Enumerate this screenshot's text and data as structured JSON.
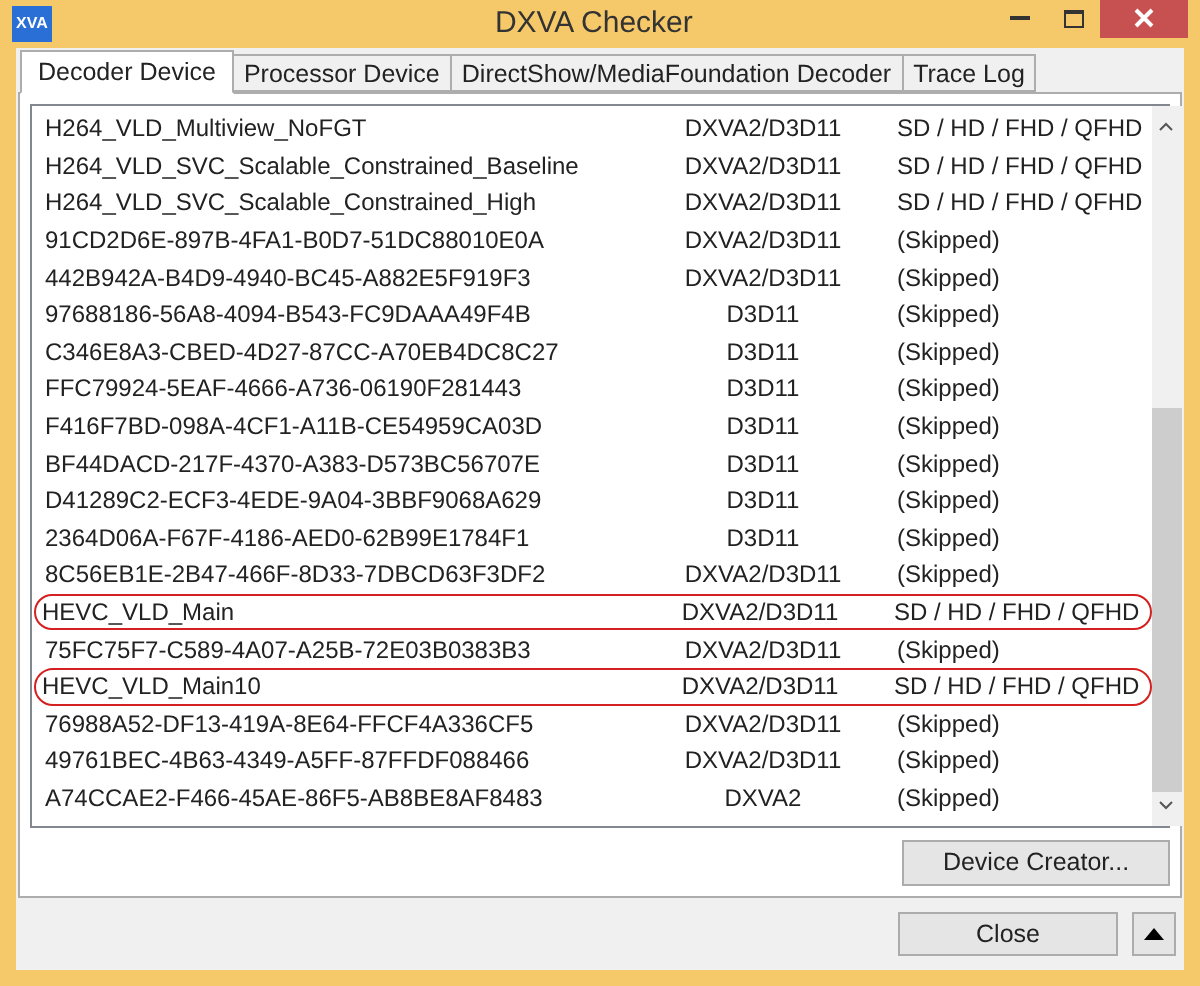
{
  "window": {
    "title": "DXVA Checker",
    "icon_text": "XVA"
  },
  "tabs": [
    {
      "label": "Decoder Device",
      "selected": true
    },
    {
      "label": "Processor Device",
      "selected": false
    },
    {
      "label": "DirectShow/MediaFoundation Decoder",
      "selected": false
    },
    {
      "label": "Trace Log",
      "selected": false
    }
  ],
  "rows": [
    {
      "name": "H264_VLD_Multiview_NoFGT",
      "api": "DXVA2/D3D11",
      "support": "SD / HD / FHD / QFHD",
      "highlighted": false
    },
    {
      "name": "H264_VLD_SVC_Scalable_Constrained_Baseline",
      "api": "DXVA2/D3D11",
      "support": "SD / HD / FHD / QFHD",
      "highlighted": false
    },
    {
      "name": "H264_VLD_SVC_Scalable_Constrained_High",
      "api": "DXVA2/D3D11",
      "support": "SD / HD / FHD / QFHD",
      "highlighted": false
    },
    {
      "name": "91CD2D6E-897B-4FA1-B0D7-51DC88010E0A",
      "api": "DXVA2/D3D11",
      "support": "(Skipped)",
      "highlighted": false
    },
    {
      "name": "442B942A-B4D9-4940-BC45-A882E5F919F3",
      "api": "DXVA2/D3D11",
      "support": "(Skipped)",
      "highlighted": false
    },
    {
      "name": "97688186-56A8-4094-B543-FC9DAAA49F4B",
      "api": "D3D11",
      "support": "(Skipped)",
      "highlighted": false
    },
    {
      "name": "C346E8A3-CBED-4D27-87CC-A70EB4DC8C27",
      "api": "D3D11",
      "support": "(Skipped)",
      "highlighted": false
    },
    {
      "name": "FFC79924-5EAF-4666-A736-06190F281443",
      "api": "D3D11",
      "support": "(Skipped)",
      "highlighted": false
    },
    {
      "name": "F416F7BD-098A-4CF1-A11B-CE54959CA03D",
      "api": "D3D11",
      "support": "(Skipped)",
      "highlighted": false
    },
    {
      "name": "BF44DACD-217F-4370-A383-D573BC56707E",
      "api": "D3D11",
      "support": "(Skipped)",
      "highlighted": false
    },
    {
      "name": "D41289C2-ECF3-4EDE-9A04-3BBF9068A629",
      "api": "D3D11",
      "support": "(Skipped)",
      "highlighted": false
    },
    {
      "name": "2364D06A-F67F-4186-AED0-62B99E1784F1",
      "api": "D3D11",
      "support": "(Skipped)",
      "highlighted": false
    },
    {
      "name": "8C56EB1E-2B47-466F-8D33-7DBCD63F3DF2",
      "api": "DXVA2/D3D11",
      "support": "(Skipped)",
      "highlighted": false
    },
    {
      "name": "HEVC_VLD_Main",
      "api": "DXVA2/D3D11",
      "support": "SD / HD / FHD / QFHD",
      "highlighted": true
    },
    {
      "name": "75FC75F7-C589-4A07-A25B-72E03B0383B3",
      "api": "DXVA2/D3D11",
      "support": "(Skipped)",
      "highlighted": false
    },
    {
      "name": "HEVC_VLD_Main10",
      "api": "DXVA2/D3D11",
      "support": "SD / HD / FHD / QFHD",
      "highlighted": true
    },
    {
      "name": "76988A52-DF13-419A-8E64-FFCF4A336CF5",
      "api": "DXVA2/D3D11",
      "support": "(Skipped)",
      "highlighted": false
    },
    {
      "name": "49761BEC-4B63-4349-A5FF-87FFDF088466",
      "api": "DXVA2/D3D11",
      "support": "(Skipped)",
      "highlighted": false
    },
    {
      "name": "A74CCAE2-F466-45AE-86F5-AB8BE8AF8483",
      "api": "DXVA2",
      "support": "(Skipped)",
      "highlighted": false
    }
  ],
  "buttons": {
    "device_creator": "Device Creator...",
    "close": "Close"
  }
}
